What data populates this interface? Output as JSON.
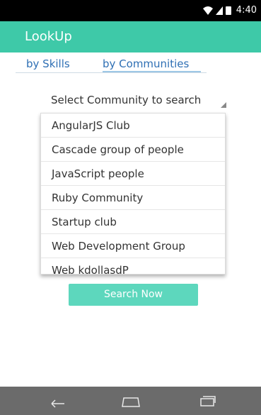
{
  "status_bar": {
    "time": "4:40"
  },
  "app": {
    "title": "LookUp"
  },
  "tabs": [
    {
      "label": "by Skills"
    },
    {
      "label": "by Communities"
    }
  ],
  "select": {
    "label": "Select Community to search"
  },
  "dropdown": {
    "options": [
      "AngularJS Club",
      "Cascade group of people",
      "JavaScript people",
      "Ruby Community",
      "Startup club",
      "Web Development Group",
      "Web kdollasdP"
    ]
  },
  "search_button": {
    "label": "Search Now"
  },
  "colors": {
    "accent": "#3ec9a8",
    "button": "#5dd7bd",
    "tab_text": "#2e6fb4",
    "nav_bar": "#6b6b6b"
  },
  "icons": {
    "status": [
      "wifi-icon",
      "signal-icon",
      "battery-icon"
    ],
    "nav": [
      "back-icon",
      "home-icon",
      "recent-apps-icon"
    ]
  }
}
